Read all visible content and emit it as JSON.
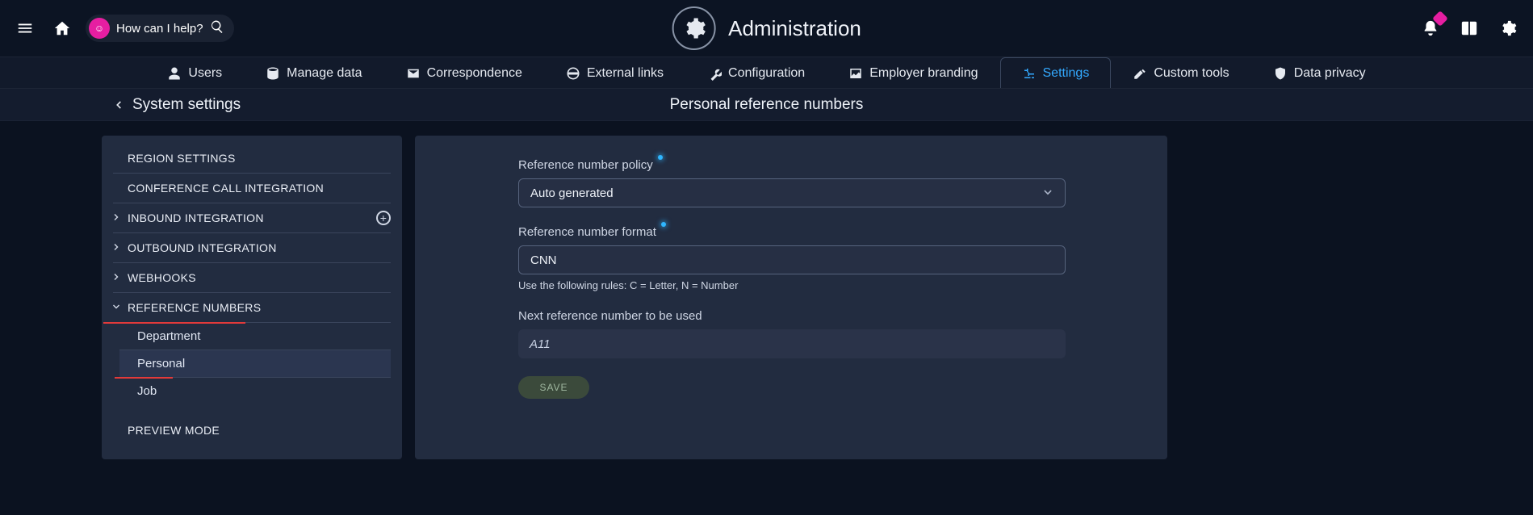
{
  "topbar": {
    "help_placeholder": "How can I help?",
    "title": "Administration"
  },
  "tabs": [
    {
      "id": "users",
      "label": "Users"
    },
    {
      "id": "manage-data",
      "label": "Manage data"
    },
    {
      "id": "correspondence",
      "label": "Correspondence"
    },
    {
      "id": "external-links",
      "label": "External links"
    },
    {
      "id": "configuration",
      "label": "Configuration"
    },
    {
      "id": "employer-branding",
      "label": "Employer branding"
    },
    {
      "id": "settings",
      "label": "Settings",
      "active": true
    },
    {
      "id": "custom-tools",
      "label": "Custom tools"
    },
    {
      "id": "data-privacy",
      "label": "Data privacy"
    }
  ],
  "subheader": {
    "back_label": "System settings",
    "page_title": "Personal reference numbers"
  },
  "sidebar": {
    "items": [
      {
        "label": "REGION SETTINGS"
      },
      {
        "label": "CONFERENCE CALL INTEGRATION"
      },
      {
        "label": "INBOUND INTEGRATION",
        "expand": true,
        "add": true
      },
      {
        "label": "OUTBOUND INTEGRATION",
        "expand": true
      },
      {
        "label": "WEBHOOKS",
        "expand": true
      },
      {
        "label": "REFERENCE NUMBERS",
        "expanded": true,
        "highlight": true,
        "children": [
          {
            "label": "Department"
          },
          {
            "label": "Personal",
            "selected": true,
            "highlight": true
          },
          {
            "label": "Job"
          }
        ]
      },
      {
        "label": "PREVIEW MODE"
      }
    ]
  },
  "form": {
    "policy_label": "Reference number policy",
    "policy_value": "Auto generated",
    "format_label": "Reference number format",
    "format_value": "CNN",
    "format_hint": "Use the following rules: C = Letter, N = Number",
    "next_label": "Next reference number to be used",
    "next_value": "A11",
    "save_label": "SAVE"
  }
}
